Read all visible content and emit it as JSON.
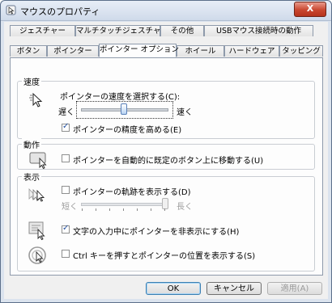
{
  "window": {
    "title": "マウスのプロパティ",
    "close_label": "X"
  },
  "tabs_back": [
    {
      "label": "ジェスチャー"
    },
    {
      "label": "マルチタッチジェスチャー"
    },
    {
      "label": "その他"
    },
    {
      "label": "USBマウス接続時の動作"
    }
  ],
  "tabs_front": [
    {
      "label": "ボタン"
    },
    {
      "label": "ポインター"
    },
    {
      "label": "ポインター オプション",
      "active": true
    },
    {
      "label": "ホイール"
    },
    {
      "label": "ハードウェア"
    },
    {
      "label": "タッピング"
    }
  ],
  "speed": {
    "group_title": "速度",
    "prompt": "ポインターの速度を選択する(C):",
    "slow_label": "遅く",
    "fast_label": "速く",
    "slider_value": 0.5,
    "precision_label": "ポインターの精度を高める(E)",
    "precision_checked": true
  },
  "snap": {
    "group_title": "動作",
    "label": "ポインターを自動的に既定のボタン上に移動する(U)",
    "checked": false
  },
  "visibility": {
    "group_title": "表示",
    "trails_label": "ポインターの軌跡を表示する(D)",
    "trails_checked": false,
    "short_label": "短く",
    "long_label": "長く",
    "trails_slider_value": 1.0,
    "hide_label": "文字の入力中にポインターを非表示にする(H)",
    "hide_checked": true,
    "ctrl_label": "Ctrl キーを押すとポインターの位置を表示する(S)",
    "ctrl_checked": false
  },
  "buttons": {
    "ok": "OK",
    "cancel": "キャンセル",
    "apply": "適用(A)"
  }
}
